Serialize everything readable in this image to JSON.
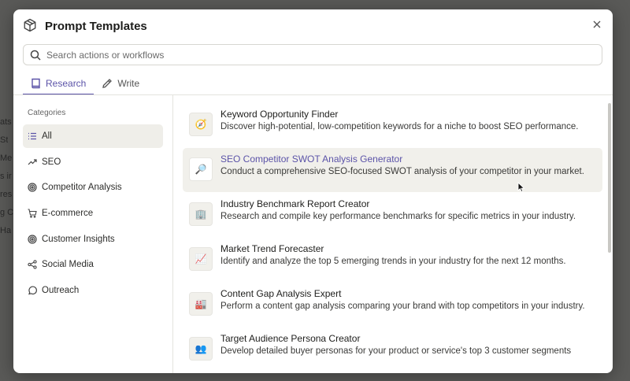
{
  "backdrop": {
    "lines": [
      "ats",
      "St",
      "Me",
      "s ir",
      "res",
      "g C",
      "Ha"
    ]
  },
  "modal": {
    "title": "Prompt Templates",
    "title_icon": "box-icon",
    "close_icon": "close-icon"
  },
  "search": {
    "placeholder": "Search actions or workflows",
    "value": "",
    "icon": "search-icon"
  },
  "tabs": [
    {
      "label": "Research",
      "icon": "book-icon",
      "active": true
    },
    {
      "label": "Write",
      "icon": "pencil-icon",
      "active": false
    }
  ],
  "sidebar": {
    "heading": "Categories",
    "items": [
      {
        "label": "All",
        "icon": "list-icon",
        "active": true
      },
      {
        "label": "SEO",
        "icon": "trend-icon",
        "active": false
      },
      {
        "label": "Competitor Analysis",
        "icon": "target-icon",
        "active": false
      },
      {
        "label": "E-commerce",
        "icon": "cart-icon",
        "active": false
      },
      {
        "label": "Customer Insights",
        "icon": "target-icon",
        "active": false
      },
      {
        "label": "Social Media",
        "icon": "share-icon",
        "active": false
      },
      {
        "label": "Outreach",
        "icon": "chat-icon",
        "active": false
      }
    ]
  },
  "templates": [
    {
      "title": "Keyword Opportunity Finder",
      "desc": "Discover high-potential, low-competition keywords for a niche to boost SEO performance.",
      "icon": "compass-icon",
      "glyph": "🧭"
    },
    {
      "title": "SEO Competitor SWOT Analysis Generator",
      "desc": "Conduct a comprehensive SEO-focused SWOT analysis of your competitor in your market.",
      "icon": "magnifier-icon",
      "glyph": "🔎"
    },
    {
      "title": "Industry Benchmark Report Creator",
      "desc": "Research and compile key performance benchmarks for specific metrics in your industry.",
      "icon": "building-icon",
      "glyph": "🏢"
    },
    {
      "title": "Market Trend Forecaster",
      "desc": "Identify and analyze the top 5 emerging trends in your industry for the next 12 months.",
      "icon": "chart-icon",
      "glyph": "📈"
    },
    {
      "title": "Content Gap Analysis Expert",
      "desc": "Perform a content gap analysis comparing your brand with top competitors in your industry.",
      "icon": "factory-icon",
      "glyph": "🏭"
    },
    {
      "title": "Target Audience Persona Creator",
      "desc": "Develop detailed buyer personas for your product or service's top 3 customer segments",
      "icon": "people-icon",
      "glyph": "👥"
    }
  ],
  "colors": {
    "accent": "#5b53a8",
    "hover_bg": "#f1f0eb"
  }
}
